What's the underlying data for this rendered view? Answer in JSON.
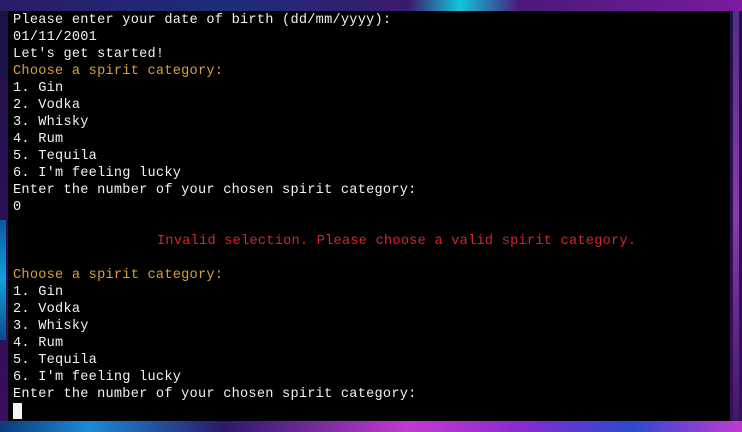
{
  "terminal": {
    "lines": [
      "Please enter your date of birth (dd/mm/yyyy):",
      "01/11/2001",
      "Let's get started!",
      "Choose a spirit category:",
      "1. Gin",
      "2. Vodka",
      "3. Whisky",
      "4. Rum",
      "5. Tequila",
      "6. I'm feeling lucky",
      "Enter the number of your chosen spirit category:",
      "0",
      "Invalid selection. Please choose a valid spirit category.",
      "Choose a spirit category:",
      "1. Gin",
      "2. Vodka",
      "3. Whisky",
      "4. Rum",
      "5. Tequila",
      "6. I'm feeling lucky",
      "Enter the number of your chosen spirit category:"
    ]
  },
  "colors": {
    "background": "#000000",
    "text": "#f2f2f2",
    "prompt": "#d7a13a",
    "error": "#d6252b",
    "cursor": "#f4f4f4"
  }
}
